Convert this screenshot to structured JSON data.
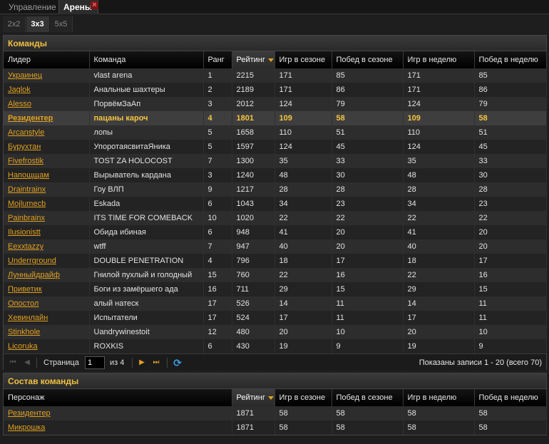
{
  "top_tabs": [
    {
      "label": "Управление"
    },
    {
      "label": "Арены",
      "close": "×"
    }
  ],
  "sub_tabs": [
    {
      "label": "2x2"
    },
    {
      "label": "3x3"
    },
    {
      "label": "5x5"
    }
  ],
  "teams_panel": {
    "title": "Команды",
    "columns": [
      "Лидер",
      "Команда",
      "Ранг",
      "Рейтинг",
      "Игр в сезоне",
      "Побед в сезоне",
      "Игр в неделю",
      "Побед в неделю"
    ],
    "sorted_column": "Рейтинг",
    "rows": [
      [
        "Украинец",
        "vlast arena",
        "1",
        "2215",
        "171",
        "85",
        "171",
        "85"
      ],
      [
        "Jaglok",
        "Анальные шахтеры",
        "2",
        "2189",
        "171",
        "86",
        "171",
        "86"
      ],
      [
        "Alesso",
        "ПорвёмЗаАп",
        "3",
        "2012",
        "124",
        "79",
        "124",
        "79"
      ],
      [
        "Резидентер",
        "пацаны кароч",
        "4",
        "1801",
        "109",
        "58",
        "109",
        "58"
      ],
      [
        "Arcanstyle",
        "лопы",
        "5",
        "1658",
        "110",
        "51",
        "110",
        "51"
      ],
      [
        "Бурухтан",
        "УпоротаясвитаЯника",
        "5",
        "1597",
        "124",
        "45",
        "124",
        "45"
      ],
      [
        "Fivefrostik",
        "TOST ZA HOLOCOST",
        "7",
        "1300",
        "35",
        "33",
        "35",
        "33"
      ],
      [
        "Напощщам",
        "Вырыватель кардана",
        "3",
        "1240",
        "48",
        "30",
        "48",
        "30"
      ],
      [
        "Draintrainx",
        "Гоу ВЛП",
        "9",
        "1217",
        "28",
        "28",
        "28",
        "28"
      ],
      [
        "Mojlumecb",
        "Eskada",
        "6",
        "1043",
        "34",
        "23",
        "34",
        "23"
      ],
      [
        "Painbrainx",
        "ITS TIME FOR COMEBACK",
        "10",
        "1020",
        "22",
        "22",
        "22",
        "22"
      ],
      [
        "Ilusionistt",
        "Обида ибиная",
        "6",
        "948",
        "41",
        "20",
        "41",
        "20"
      ],
      [
        "Eexxtazzy",
        "wtff",
        "7",
        "947",
        "40",
        "20",
        "40",
        "20"
      ],
      [
        "Underrground",
        "DOUBLE PENETRATION",
        "4",
        "796",
        "18",
        "17",
        "18",
        "17"
      ],
      [
        "Лунныйдрайф",
        "Гнилой пухлый и голодный",
        "15",
        "760",
        "22",
        "16",
        "22",
        "16"
      ],
      [
        "Приветик",
        "Боги из замёршего ада",
        "16",
        "711",
        "29",
        "15",
        "29",
        "15"
      ],
      [
        "Опостол",
        "алый натеск",
        "17",
        "526",
        "14",
        "11",
        "14",
        "11"
      ],
      [
        "Хевинлайн",
        "Испытатели",
        "17",
        "524",
        "17",
        "11",
        "17",
        "11"
      ],
      [
        "Stinkhole",
        "Uandrywinestoit",
        "12",
        "480",
        "20",
        "10",
        "20",
        "10"
      ],
      [
        "Licoruka",
        "ROXKIS",
        "6",
        "430",
        "19",
        "9",
        "19",
        "9"
      ]
    ],
    "selected_row": 3,
    "pager": {
      "page_label": "Страница",
      "page_value": "1",
      "of_label": "из 4",
      "summary": "Показаны записи 1 - 20 (всего 70)"
    }
  },
  "roster_panel": {
    "title": "Состав команды",
    "columns": [
      "Персонаж",
      "Рейтинг",
      "Игр в сезоне",
      "Побед в сезоне",
      "Игр в неделю",
      "Побед в неделю"
    ],
    "sorted_column": "Рейтинг",
    "rows": [
      [
        "Резидентер",
        "1871",
        "58",
        "58",
        "58",
        "58"
      ],
      [
        "Микрошка",
        "1871",
        "58",
        "58",
        "58",
        "58"
      ]
    ]
  },
  "colors": {
    "accent": "#e0a020",
    "header_text": "#f0c040",
    "selected_text": "#f5c542"
  },
  "icons": [
    "close-icon",
    "first-page-icon",
    "prev-page-icon",
    "next-page-icon",
    "last-page-icon",
    "refresh-icon",
    "sort-desc-icon"
  ]
}
